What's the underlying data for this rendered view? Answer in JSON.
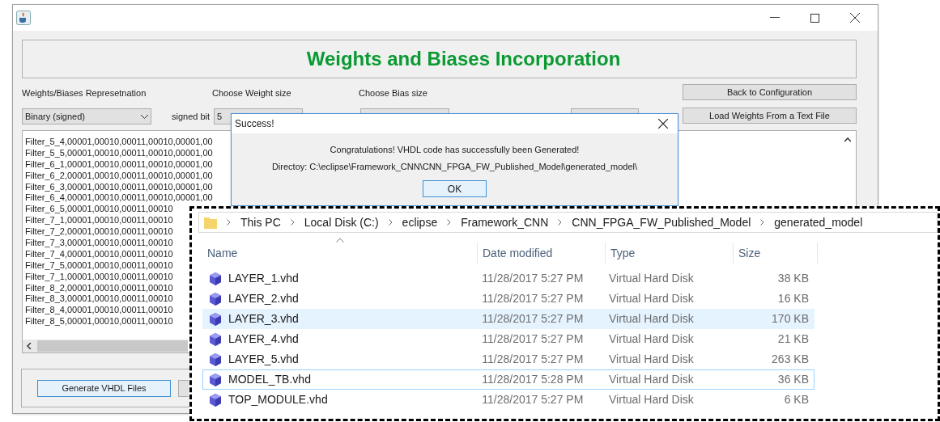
{
  "main_window": {
    "heading": "Weights and Biases Incorporation",
    "labels": [
      "Weights/Biases Represetnation",
      "Choose Weight size",
      "Choose Bias size"
    ],
    "representation": {
      "value": "Binary (signed)"
    },
    "signed_bit": {
      "label": "signed bit",
      "value": "5"
    },
    "buttons": [
      "Back to Configuration",
      "Load Weights From a Text File"
    ],
    "text_area": {
      "lines": [
        "Filter_5_4,00001,00010,00011,00010,00001,00",
        "Filter_5_5,00001,00010,00011,00010,00001,00",
        "Filter_6_1,00001,00010,00011,00010,00001,00",
        "Filter_6_2,00001,00010,00011,00010,00001,00",
        "Filter_6_3,00001,00010,00011,00010,00001,00",
        "Filter_6_4,00001,00010,00011,00010,00001,00",
        "Filter_6_5,00001,00010,00011,00010",
        "Filter_7_1,00001,00010,00011,00010",
        "Filter_7_2,00001,00010,00011,00010",
        "Filter_7_3,00001,00010,00011,00010",
        "Filter_7_4,00001,00010,00011,00010",
        "Filter_7_5,00001,00010,00011,00010",
        "Filter_7_1,00001,00010,00011,00010",
        "Filter_8_2,00001,00010,00011,00010",
        "Filter_8_3,00001,00010,00011,00010",
        "Filter_8_4,00001,00010,00011,00010",
        "Filter_8_5,00001,00010,00011,00010"
      ]
    },
    "generate_button": "Generate VHDL Files"
  },
  "dialog": {
    "title": "Success!",
    "messages": [
      "Congratulations! VHDL code has successfully been Generated!",
      "Directoy: C:\\eclipse\\Framework_CNN\\CNN_FPGA_FW_Published_Model\\generated_model\\"
    ],
    "ok_button": "OK"
  },
  "explorer": {
    "breadcrumbs": [
      "This PC",
      "Local Disk (C:)",
      "eclipse",
      "Framework_CNN",
      "CNN_FPGA_FW_Published_Model",
      "generated_model"
    ],
    "columns": [
      "Name",
      "Date modified",
      "Type",
      "Size"
    ],
    "files": [
      {
        "name": "LAYER_1.vhd",
        "date": "11/28/2017 5:27 PM",
        "type": "Virtual Hard Disk",
        "size": "38 KB",
        "selected": false,
        "focused": false
      },
      {
        "name": "LAYER_2.vhd",
        "date": "11/28/2017 5:27 PM",
        "type": "Virtual Hard Disk",
        "size": "16 KB",
        "selected": false,
        "focused": false
      },
      {
        "name": "LAYER_3.vhd",
        "date": "11/28/2017 5:27 PM",
        "type": "Virtual Hard Disk",
        "size": "170 KB",
        "selected": true,
        "focused": false
      },
      {
        "name": "LAYER_4.vhd",
        "date": "11/28/2017 5:27 PM",
        "type": "Virtual Hard Disk",
        "size": "21 KB",
        "selected": false,
        "focused": false
      },
      {
        "name": "LAYER_5.vhd",
        "date": "11/28/2017 5:27 PM",
        "type": "Virtual Hard Disk",
        "size": "263 KB",
        "selected": false,
        "focused": false
      },
      {
        "name": "MODEL_TB.vhd",
        "date": "11/28/2017 5:28 PM",
        "type": "Virtual Hard Disk",
        "size": "36 KB",
        "selected": false,
        "focused": true
      },
      {
        "name": "TOP_MODULE.vhd",
        "date": "11/28/2017 5:27 PM",
        "type": "Virtual Hard Disk",
        "size": "6 KB",
        "selected": false,
        "focused": false
      }
    ]
  }
}
